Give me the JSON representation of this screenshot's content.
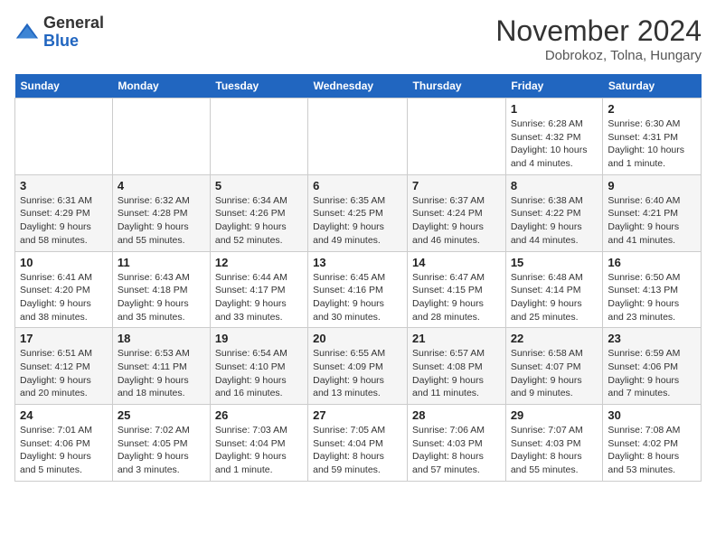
{
  "logo": {
    "general": "General",
    "blue": "Blue"
  },
  "header": {
    "month": "November 2024",
    "location": "Dobrokoz, Tolna, Hungary"
  },
  "weekdays": [
    "Sunday",
    "Monday",
    "Tuesday",
    "Wednesday",
    "Thursday",
    "Friday",
    "Saturday"
  ],
  "weeks": [
    [
      {
        "day": "",
        "info": ""
      },
      {
        "day": "",
        "info": ""
      },
      {
        "day": "",
        "info": ""
      },
      {
        "day": "",
        "info": ""
      },
      {
        "day": "",
        "info": ""
      },
      {
        "day": "1",
        "info": "Sunrise: 6:28 AM\nSunset: 4:32 PM\nDaylight: 10 hours and 4 minutes."
      },
      {
        "day": "2",
        "info": "Sunrise: 6:30 AM\nSunset: 4:31 PM\nDaylight: 10 hours and 1 minute."
      }
    ],
    [
      {
        "day": "3",
        "info": "Sunrise: 6:31 AM\nSunset: 4:29 PM\nDaylight: 9 hours and 58 minutes."
      },
      {
        "day": "4",
        "info": "Sunrise: 6:32 AM\nSunset: 4:28 PM\nDaylight: 9 hours and 55 minutes."
      },
      {
        "day": "5",
        "info": "Sunrise: 6:34 AM\nSunset: 4:26 PM\nDaylight: 9 hours and 52 minutes."
      },
      {
        "day": "6",
        "info": "Sunrise: 6:35 AM\nSunset: 4:25 PM\nDaylight: 9 hours and 49 minutes."
      },
      {
        "day": "7",
        "info": "Sunrise: 6:37 AM\nSunset: 4:24 PM\nDaylight: 9 hours and 46 minutes."
      },
      {
        "day": "8",
        "info": "Sunrise: 6:38 AM\nSunset: 4:22 PM\nDaylight: 9 hours and 44 minutes."
      },
      {
        "day": "9",
        "info": "Sunrise: 6:40 AM\nSunset: 4:21 PM\nDaylight: 9 hours and 41 minutes."
      }
    ],
    [
      {
        "day": "10",
        "info": "Sunrise: 6:41 AM\nSunset: 4:20 PM\nDaylight: 9 hours and 38 minutes."
      },
      {
        "day": "11",
        "info": "Sunrise: 6:43 AM\nSunset: 4:18 PM\nDaylight: 9 hours and 35 minutes."
      },
      {
        "day": "12",
        "info": "Sunrise: 6:44 AM\nSunset: 4:17 PM\nDaylight: 9 hours and 33 minutes."
      },
      {
        "day": "13",
        "info": "Sunrise: 6:45 AM\nSunset: 4:16 PM\nDaylight: 9 hours and 30 minutes."
      },
      {
        "day": "14",
        "info": "Sunrise: 6:47 AM\nSunset: 4:15 PM\nDaylight: 9 hours and 28 minutes."
      },
      {
        "day": "15",
        "info": "Sunrise: 6:48 AM\nSunset: 4:14 PM\nDaylight: 9 hours and 25 minutes."
      },
      {
        "day": "16",
        "info": "Sunrise: 6:50 AM\nSunset: 4:13 PM\nDaylight: 9 hours and 23 minutes."
      }
    ],
    [
      {
        "day": "17",
        "info": "Sunrise: 6:51 AM\nSunset: 4:12 PM\nDaylight: 9 hours and 20 minutes."
      },
      {
        "day": "18",
        "info": "Sunrise: 6:53 AM\nSunset: 4:11 PM\nDaylight: 9 hours and 18 minutes."
      },
      {
        "day": "19",
        "info": "Sunrise: 6:54 AM\nSunset: 4:10 PM\nDaylight: 9 hours and 16 minutes."
      },
      {
        "day": "20",
        "info": "Sunrise: 6:55 AM\nSunset: 4:09 PM\nDaylight: 9 hours and 13 minutes."
      },
      {
        "day": "21",
        "info": "Sunrise: 6:57 AM\nSunset: 4:08 PM\nDaylight: 9 hours and 11 minutes."
      },
      {
        "day": "22",
        "info": "Sunrise: 6:58 AM\nSunset: 4:07 PM\nDaylight: 9 hours and 9 minutes."
      },
      {
        "day": "23",
        "info": "Sunrise: 6:59 AM\nSunset: 4:06 PM\nDaylight: 9 hours and 7 minutes."
      }
    ],
    [
      {
        "day": "24",
        "info": "Sunrise: 7:01 AM\nSunset: 4:06 PM\nDaylight: 9 hours and 5 minutes."
      },
      {
        "day": "25",
        "info": "Sunrise: 7:02 AM\nSunset: 4:05 PM\nDaylight: 9 hours and 3 minutes."
      },
      {
        "day": "26",
        "info": "Sunrise: 7:03 AM\nSunset: 4:04 PM\nDaylight: 9 hours and 1 minute."
      },
      {
        "day": "27",
        "info": "Sunrise: 7:05 AM\nSunset: 4:04 PM\nDaylight: 8 hours and 59 minutes."
      },
      {
        "day": "28",
        "info": "Sunrise: 7:06 AM\nSunset: 4:03 PM\nDaylight: 8 hours and 57 minutes."
      },
      {
        "day": "29",
        "info": "Sunrise: 7:07 AM\nSunset: 4:03 PM\nDaylight: 8 hours and 55 minutes."
      },
      {
        "day": "30",
        "info": "Sunrise: 7:08 AM\nSunset: 4:02 PM\nDaylight: 8 hours and 53 minutes."
      }
    ]
  ]
}
